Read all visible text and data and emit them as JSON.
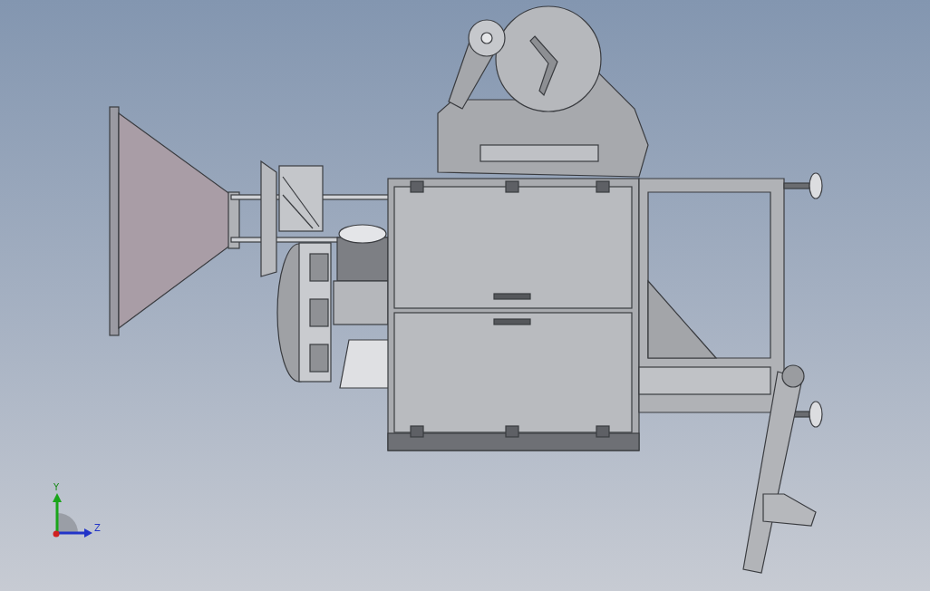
{
  "viewport": {
    "triad": {
      "axes": [
        {
          "label": "Y"
        },
        {
          "label": "Z"
        }
      ]
    }
  }
}
